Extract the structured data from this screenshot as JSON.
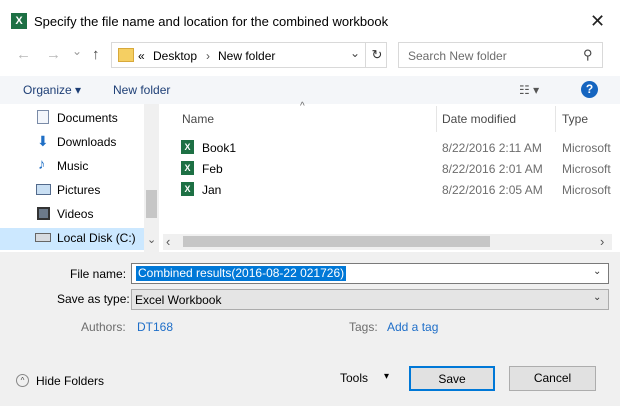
{
  "window": {
    "title": "Specify the file name and location for the combined workbook",
    "app_icon_glyph": "X",
    "close_glyph": "✕"
  },
  "nav": {
    "back_glyph": "←",
    "forward_glyph": "→",
    "dropdown_glyph": "⌄",
    "up_glyph": "↑",
    "refresh_glyph": "↻"
  },
  "address": {
    "prefix": "«",
    "crumbs": [
      "Desktop",
      "New folder"
    ],
    "sep": "›",
    "dropdown_glyph": "⌄"
  },
  "search": {
    "placeholder": "Search New folder",
    "icon_glyph": "⚲"
  },
  "toolbar": {
    "organize": "Organize ▾",
    "new_folder": "New folder",
    "view_glyph": "☷ ▾",
    "help_glyph": "?"
  },
  "sidebar": {
    "items": [
      {
        "label": "Documents",
        "icon": "documents-icon"
      },
      {
        "label": "Downloads",
        "icon": "downloads-icon"
      },
      {
        "label": "Music",
        "icon": "music-icon"
      },
      {
        "label": "Pictures",
        "icon": "pictures-icon"
      },
      {
        "label": "Videos",
        "icon": "videos-icon"
      },
      {
        "label": "Local Disk (C:)",
        "icon": "local-disk-icon",
        "selected": true
      }
    ],
    "scroll_down_glyph": "⌄"
  },
  "files": {
    "columns": [
      "Name",
      "Date modified",
      "Type"
    ],
    "sort_glyph": "^",
    "rows": [
      {
        "name": "Book1",
        "date": "8/22/2016 2:11 AM",
        "type": "Microsoft Excel"
      },
      {
        "name": "Feb",
        "date": "8/22/2016 2:01 AM",
        "type": "Microsoft Excel"
      },
      {
        "name": "Jan",
        "date": "8/22/2016 2:05 AM",
        "type": "Microsoft Excel"
      }
    ],
    "scroll_left_glyph": "‹",
    "scroll_right_glyph": "›"
  },
  "form": {
    "file_name_label": "File name:",
    "file_name_value": "Combined results(2016-08-22 021726)",
    "save_type_label": "Save as type:",
    "save_type_value": "Excel Workbook",
    "authors_label": "Authors:",
    "authors_value": "DT168",
    "tags_label": "Tags:",
    "tags_value": "Add a tag",
    "dropdown_glyph": "⌄"
  },
  "footer": {
    "hide_folders": "Hide Folders",
    "hide_glyph": "^",
    "tools": "Tools",
    "tools_glyph": "▾",
    "save": "Save",
    "cancel": "Cancel"
  },
  "colors": {
    "accent": "#0078d7",
    "excel_green": "#1d7044",
    "link": "#1e6ec8"
  }
}
